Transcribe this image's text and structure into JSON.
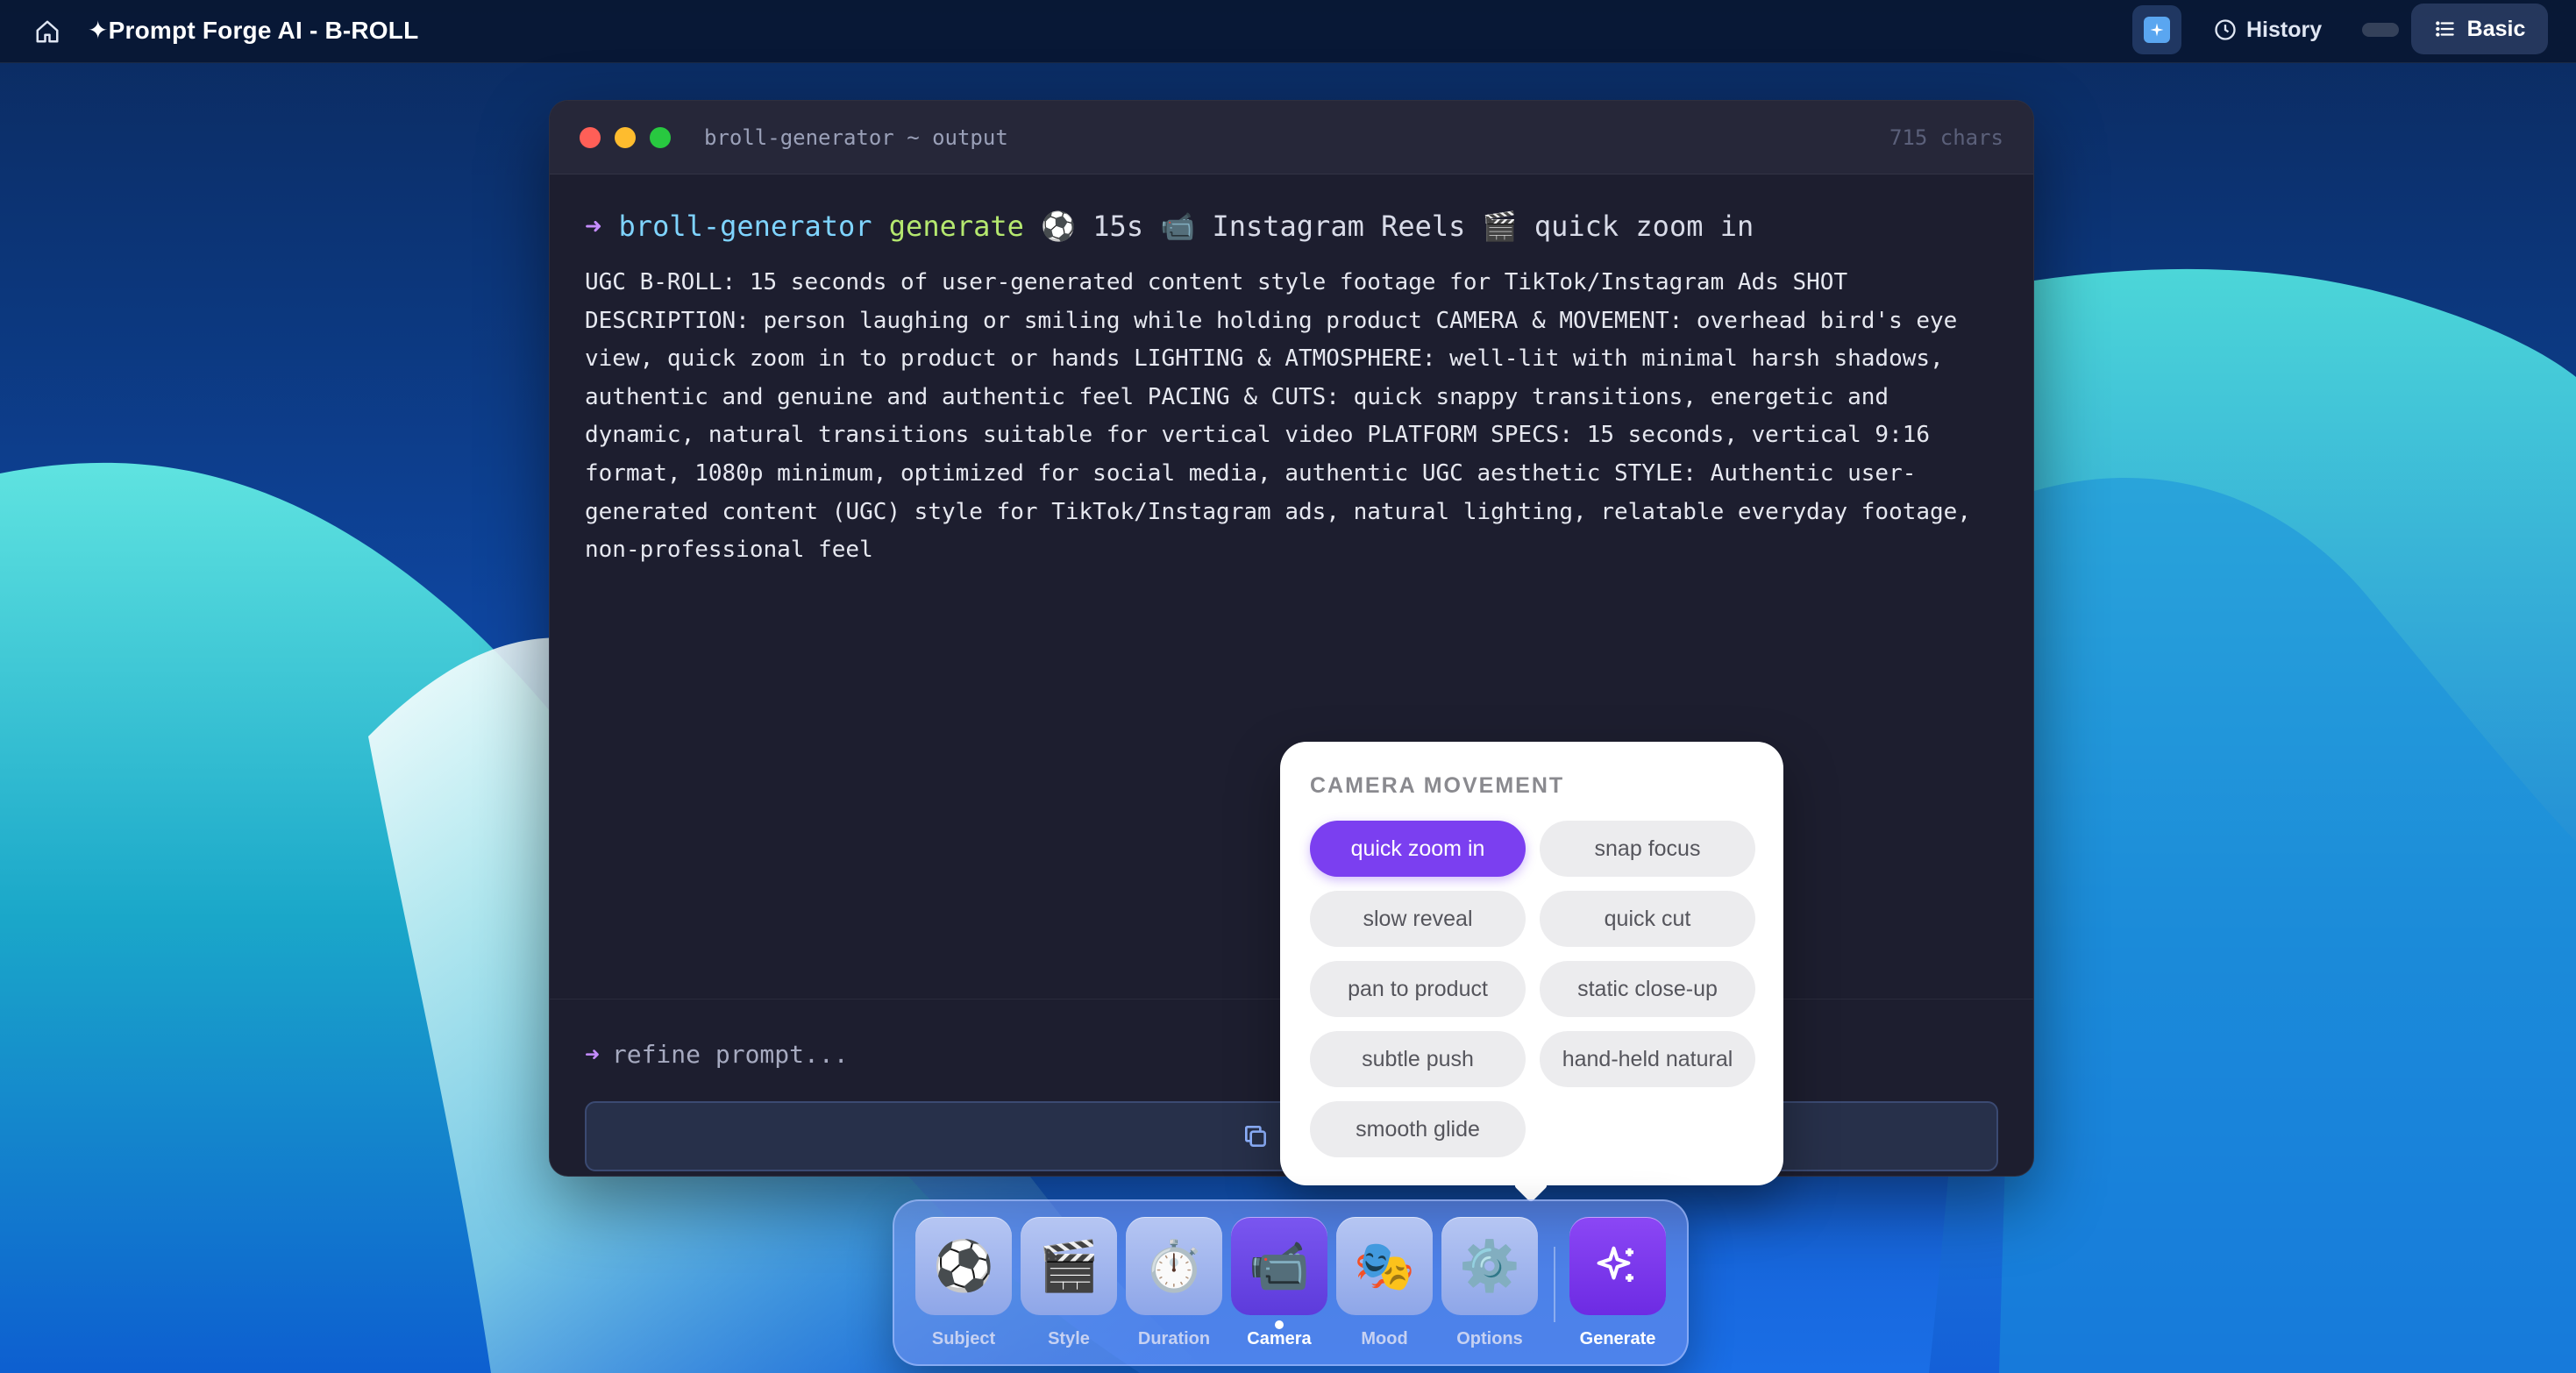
{
  "app": {
    "title": "✦Prompt Forge AI - B-ROLL"
  },
  "topbar": {
    "history_label": "History",
    "basic_label": "Basic"
  },
  "terminal": {
    "title": "broll-generator ~ output",
    "char_count": "715 chars",
    "command": {
      "arrow": "➜",
      "program": "broll-generator",
      "verb": "generate",
      "args": "⚽ 15s 📹 Instagram Reels 🎬 quick zoom in"
    },
    "output": "UGC B-ROLL: 15 seconds of user-generated content style footage for TikTok/Instagram Ads SHOT DESCRIPTION: person laughing or smiling while holding product CAMERA & MOVEMENT: overhead bird's eye view, quick zoom in to product or hands LIGHTING & ATMOSPHERE: well-lit with minimal harsh shadows, authentic and genuine and authentic feel PACING & CUTS: quick snappy transitions, energetic and dynamic, natural transitions suitable for vertical video PLATFORM SPECS: 15 seconds, vertical 9:16 format, 1080p minimum, optimized for social media, authentic UGC aesthetic STYLE: Authentic user-generated content (UGC) style for TikTok/Instagram ads, natural lighting, relatable everyday footage, non-professional feel",
    "refine_arrow": "➜",
    "refine_placeholder": "refine prompt...",
    "copy_label": "copy"
  },
  "popover": {
    "title": "CAMERA MOVEMENT",
    "options": [
      {
        "label": "quick zoom in",
        "active": true
      },
      {
        "label": "snap focus",
        "active": false
      },
      {
        "label": "slow reveal",
        "active": false
      },
      {
        "label": "quick cut",
        "active": false
      },
      {
        "label": "pan to product",
        "active": false
      },
      {
        "label": "static close-up",
        "active": false
      },
      {
        "label": "subtle push",
        "active": false
      },
      {
        "label": "hand-held natural",
        "active": false
      },
      {
        "label": "smooth glide",
        "active": false
      }
    ]
  },
  "dock": {
    "items": [
      {
        "label": "Subject",
        "icon": "⚽",
        "icon_name": "soccer-ball-icon"
      },
      {
        "label": "Style",
        "icon": "🎬",
        "icon_name": "clapperboard-icon"
      },
      {
        "label": "Duration",
        "icon": "⏱️",
        "icon_name": "stopwatch-icon"
      },
      {
        "label": "Camera",
        "icon": "📹",
        "icon_name": "video-camera-icon",
        "active": true
      },
      {
        "label": "Mood",
        "icon": "🎭",
        "icon_name": "theater-masks-icon"
      },
      {
        "label": "Options",
        "icon": "⚙️",
        "icon_name": "gear-icon"
      }
    ],
    "generate_label": "Generate"
  },
  "colors": {
    "accent": "#7b3ff0",
    "terminal_bg": "#1d1e2f",
    "program": "#7fd4ff",
    "verb": "#b5e86f",
    "prompt_arrow": "#c58cff"
  }
}
